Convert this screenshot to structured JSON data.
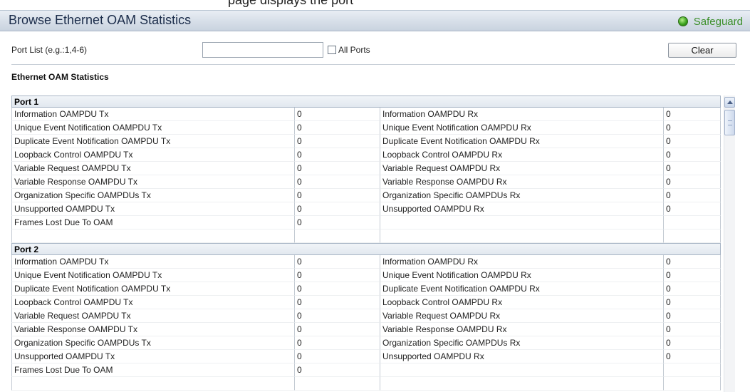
{
  "header": {
    "title": "Browse Ethernet OAM Statistics",
    "safeguard_label": "Safeguard",
    "safeguard_color": "#3c8f2a",
    "top_clipped_text": "page displays the port"
  },
  "form": {
    "port_list_label": "Port List (e.g.:1,4-6)",
    "port_list_value": "",
    "all_ports_label": "All Ports",
    "all_ports_checked": false,
    "clear_label": "Clear"
  },
  "section_title": "Ethernet OAM Statistics",
  "ports": [
    {
      "name": "Port 1",
      "rows": [
        {
          "tx_label": "Information OAMPDU Tx",
          "tx_value": "0",
          "rx_label": "Information OAMPDU Rx",
          "rx_value": "0"
        },
        {
          "tx_label": "Unique Event Notification OAMPDU Tx",
          "tx_value": "0",
          "rx_label": "Unique Event Notification OAMPDU Rx",
          "rx_value": "0"
        },
        {
          "tx_label": "Duplicate Event Notification OAMPDU Tx",
          "tx_value": "0",
          "rx_label": "Duplicate Event Notification OAMPDU Rx",
          "rx_value": "0"
        },
        {
          "tx_label": "Loopback Control OAMPDU Tx",
          "tx_value": "0",
          "rx_label": "Loopback Control OAMPDU Rx",
          "rx_value": "0"
        },
        {
          "tx_label": "Variable Request OAMPDU Tx",
          "tx_value": "0",
          "rx_label": "Variable Request OAMPDU Rx",
          "rx_value": "0"
        },
        {
          "tx_label": "Variable Response OAMPDU Tx",
          "tx_value": "0",
          "rx_label": "Variable Response OAMPDU Rx",
          "rx_value": "0"
        },
        {
          "tx_label": "Organization Specific OAMPDUs Tx",
          "tx_value": "0",
          "rx_label": "Organization Specific OAMPDUs Rx",
          "rx_value": "0"
        },
        {
          "tx_label": "Unsupported OAMPDU Tx",
          "tx_value": "0",
          "rx_label": "Unsupported OAMPDU Rx",
          "rx_value": "0"
        },
        {
          "tx_label": "Frames Lost Due To OAM",
          "tx_value": "0",
          "rx_label": "",
          "rx_value": ""
        },
        {
          "tx_label": "",
          "tx_value": "",
          "rx_label": "",
          "rx_value": ""
        }
      ]
    },
    {
      "name": "Port 2",
      "rows": [
        {
          "tx_label": "Information OAMPDU Tx",
          "tx_value": "0",
          "rx_label": "Information OAMPDU Rx",
          "rx_value": "0"
        },
        {
          "tx_label": "Unique Event Notification OAMPDU Tx",
          "tx_value": "0",
          "rx_label": "Unique Event Notification OAMPDU Rx",
          "rx_value": "0"
        },
        {
          "tx_label": "Duplicate Event Notification OAMPDU Tx",
          "tx_value": "0",
          "rx_label": "Duplicate Event Notification OAMPDU Rx",
          "rx_value": "0"
        },
        {
          "tx_label": "Loopback Control OAMPDU Tx",
          "tx_value": "0",
          "rx_label": "Loopback Control OAMPDU Rx",
          "rx_value": "0"
        },
        {
          "tx_label": "Variable Request OAMPDU Tx",
          "tx_value": "0",
          "rx_label": "Variable Request OAMPDU Rx",
          "rx_value": "0"
        },
        {
          "tx_label": "Variable Response OAMPDU Tx",
          "tx_value": "0",
          "rx_label": "Variable Response OAMPDU Rx",
          "rx_value": "0"
        },
        {
          "tx_label": "Organization Specific OAMPDUs Tx",
          "tx_value": "0",
          "rx_label": "Organization Specific OAMPDUs Rx",
          "rx_value": "0"
        },
        {
          "tx_label": "Unsupported OAMPDU Tx",
          "tx_value": "0",
          "rx_label": "Unsupported OAMPDU Rx",
          "rx_value": "0"
        },
        {
          "tx_label": "Frames Lost Due To OAM",
          "tx_value": "0",
          "rx_label": "",
          "rx_value": ""
        },
        {
          "tx_label": "",
          "tx_value": "",
          "rx_label": "",
          "rx_value": ""
        }
      ]
    }
  ]
}
